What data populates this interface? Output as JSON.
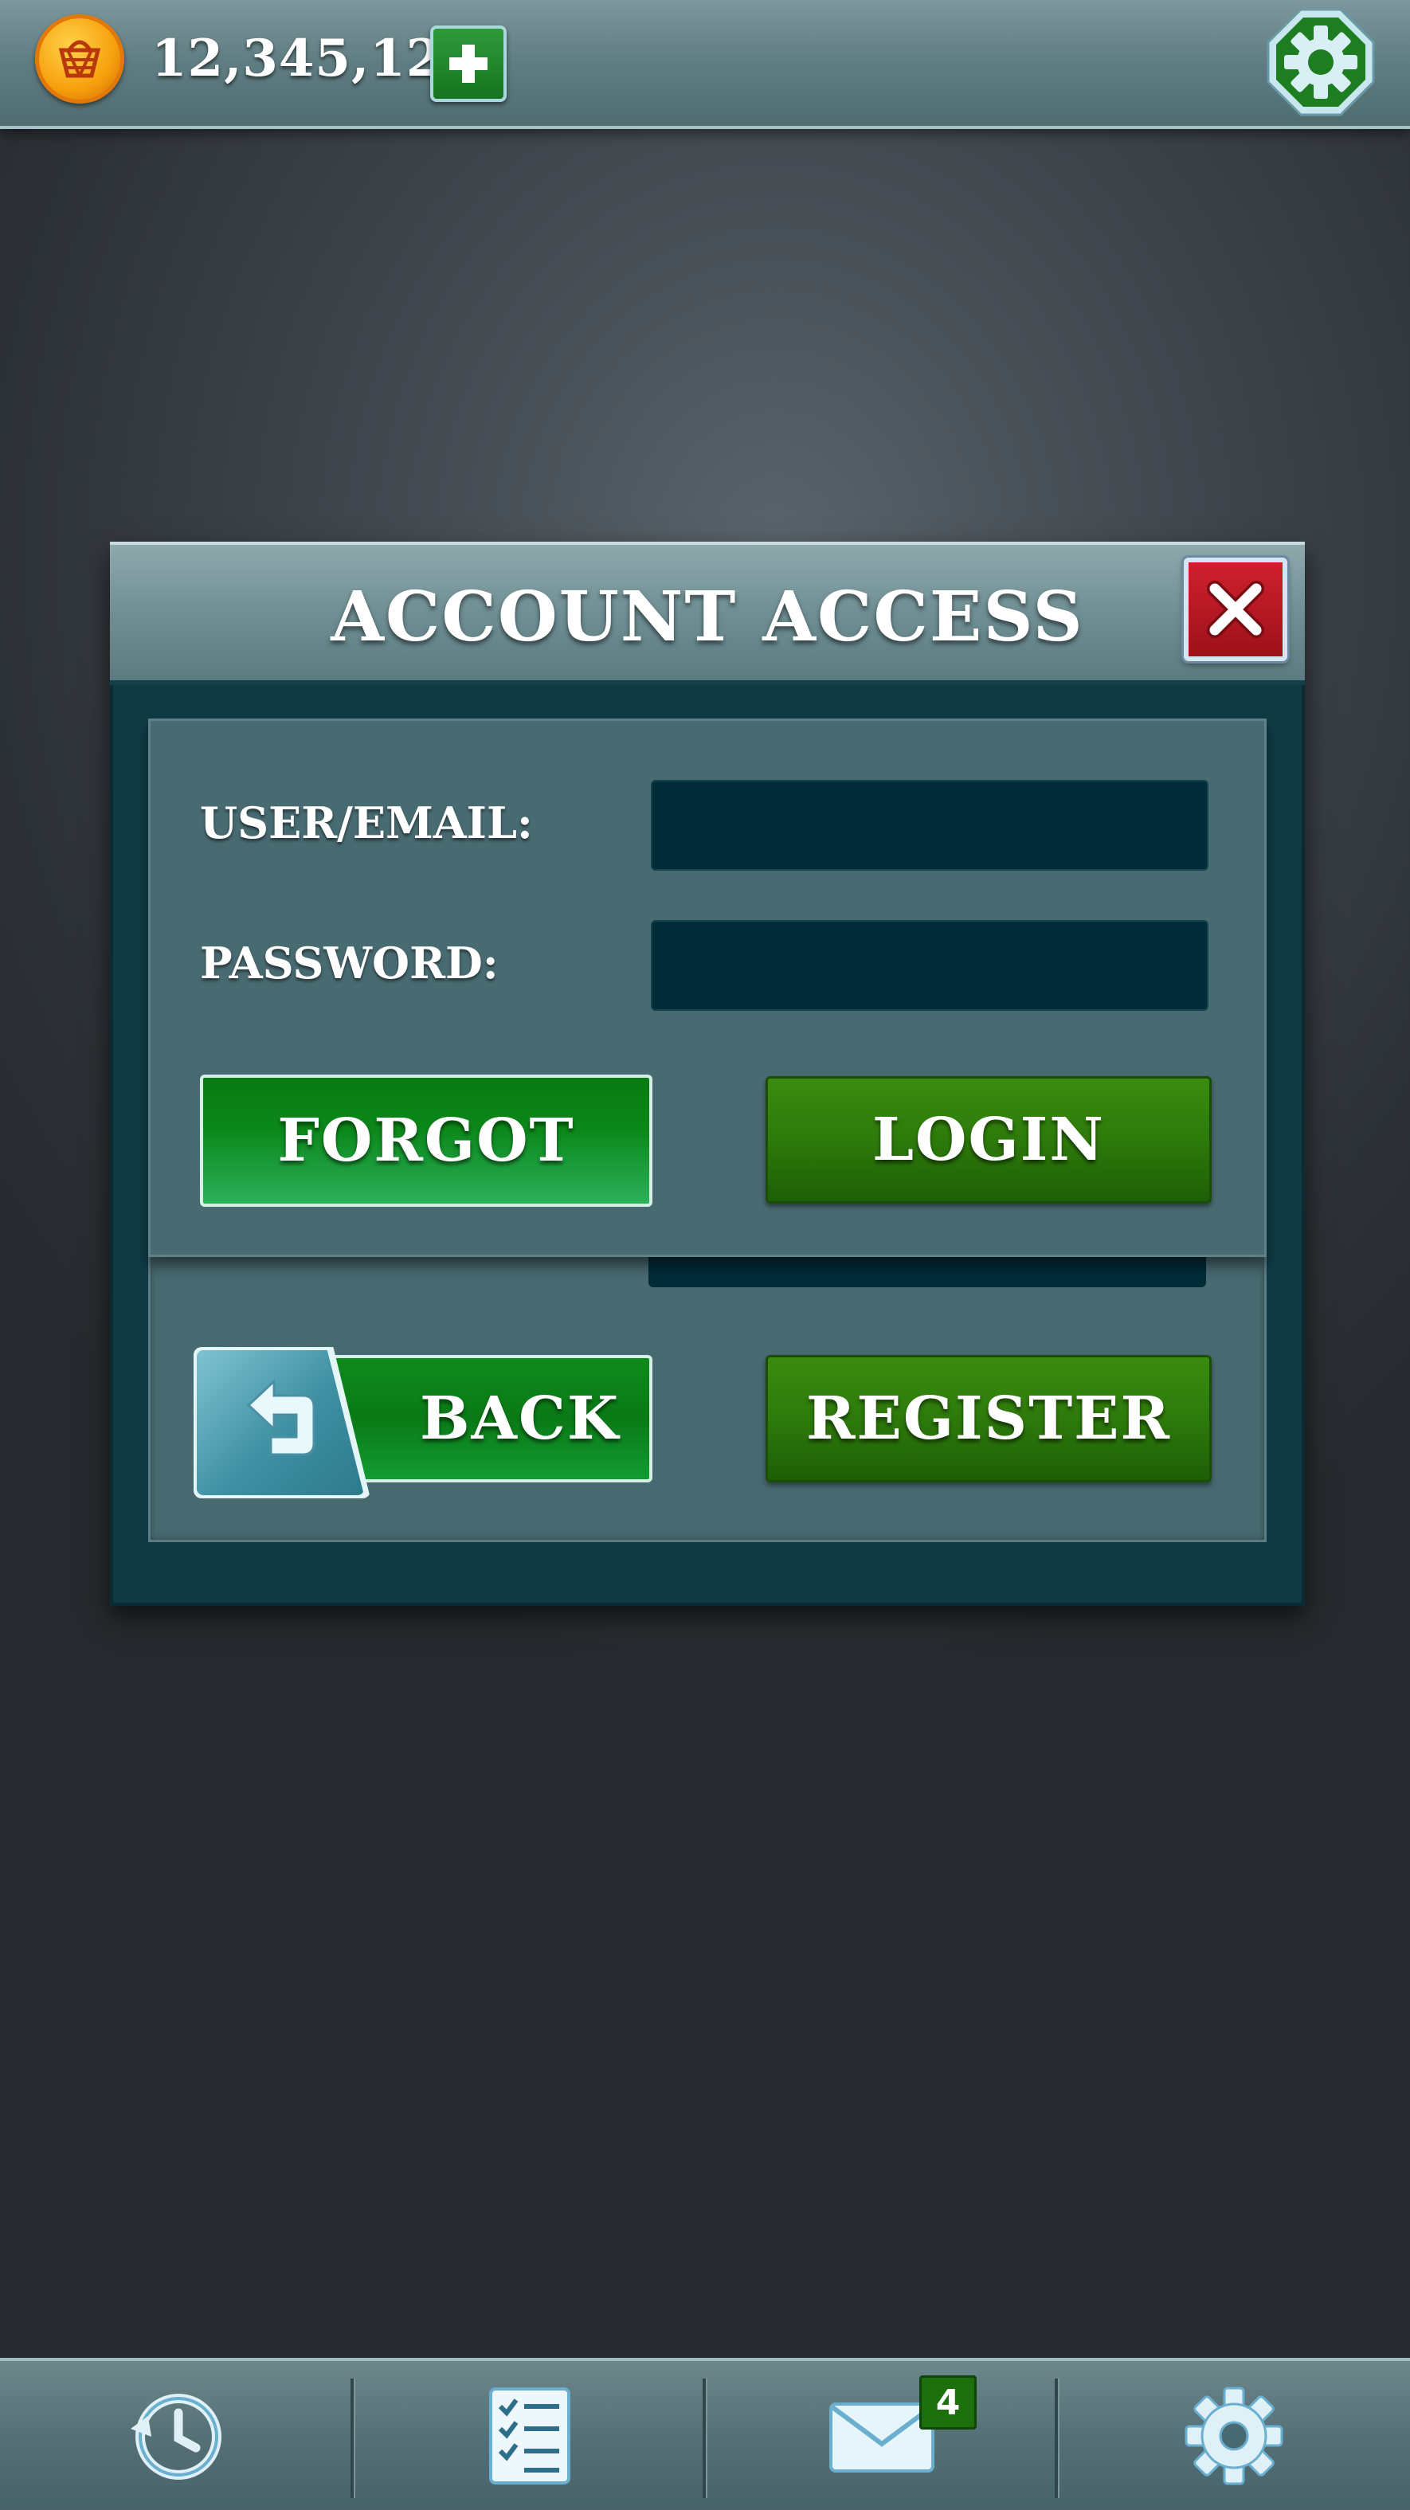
{
  "header": {
    "currency_amount": "12,345,123",
    "coin_icon": "coin-basket-icon",
    "add_currency_icon": "plus-icon",
    "settings_icon": "gear-icon"
  },
  "modal": {
    "title": "ACCOUNT ACCESS",
    "close_icon": "close-x-icon",
    "user_label": "USER/EMAIL:",
    "password_label": "PASSWORD:",
    "user_value": "",
    "password_value": "",
    "forgot_label": "FORGOT",
    "login_label": "LOGIN",
    "back_label": "BACK",
    "register_label": "REGISTER"
  },
  "bottom_nav": {
    "items": [
      {
        "icon": "history-icon"
      },
      {
        "icon": "checklist-icon"
      },
      {
        "icon": "mail-icon",
        "badge": "4"
      },
      {
        "icon": "settings-gear-icon"
      }
    ]
  },
  "colors": {
    "accent_green": "#2d7a0b",
    "close_red": "#c81a26",
    "panel_teal": "#476970",
    "field_dark": "#022c38"
  }
}
